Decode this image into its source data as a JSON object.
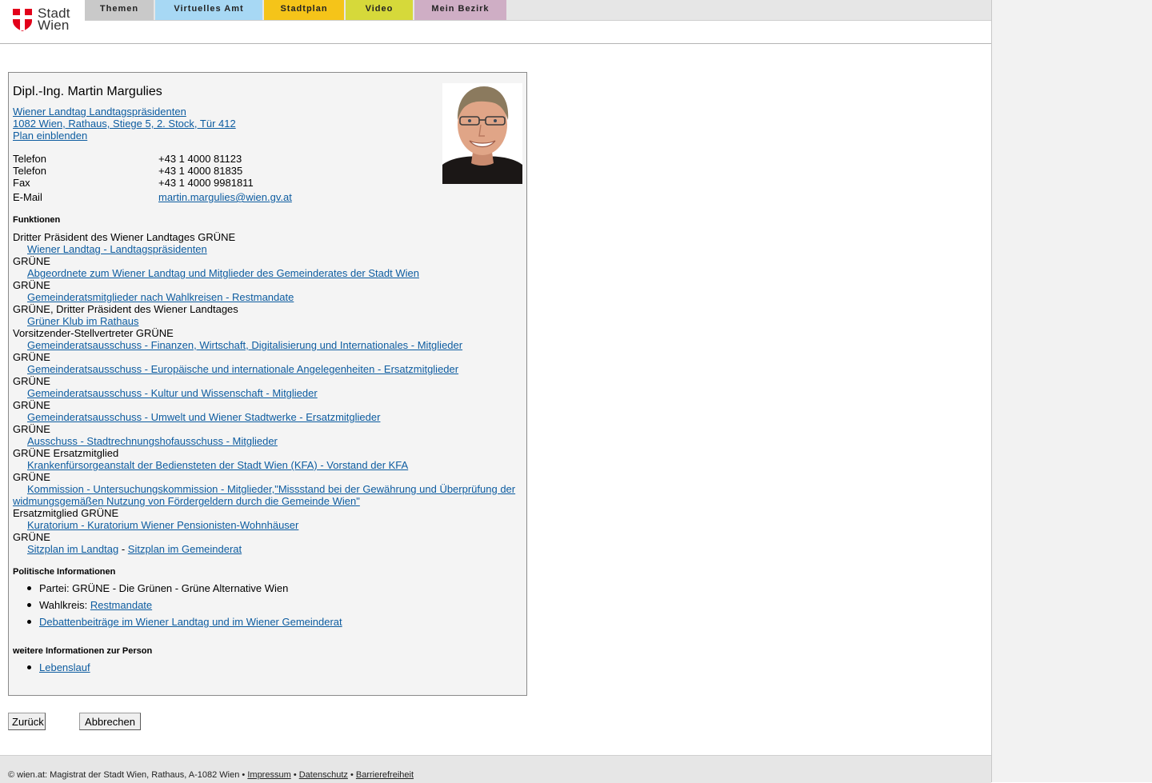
{
  "header": {
    "logo_line1": "Stadt",
    "logo_line2": "Wien",
    "nav": [
      "Themen",
      "Virtuelles Amt",
      "Stadtplan",
      "Video",
      "Mein Bezirk"
    ]
  },
  "person": {
    "name": "Dipl.-Ing. Martin Margulies",
    "org_link": "Wiener Landtag Landtagspräsidenten",
    "address_link": "1082 Wien, Rathaus, Stiege 5, 2. Stock, Tür 412",
    "plan_link": "Plan einblenden",
    "contacts": [
      {
        "label": "Telefon",
        "value": "+43 1 4000 81123"
      },
      {
        "label": "Telefon",
        "value": "+43 1 4000 81835"
      },
      {
        "label": "Fax",
        "value": "+43 1 4000 9981811"
      }
    ],
    "email_label": "E-Mail",
    "email": "martin.margulies@wien.gv.at"
  },
  "funktionen": {
    "heading": "Funktionen",
    "items": [
      {
        "role": "Dritter Präsident des Wiener Landtages GRÜNE",
        "link": "Wiener Landtag - Landtagspräsidenten"
      },
      {
        "role": "GRÜNE",
        "link": "Abgeordnete zum Wiener Landtag und Mitglieder des Gemeinderates der Stadt Wien"
      },
      {
        "role": "GRÜNE",
        "link": "Gemeinderatsmitglieder nach Wahlkreisen - Restmandate"
      },
      {
        "role": "GRÜNE, Dritter Präsident des Wiener Landtages",
        "link": "Grüner Klub im Rathaus"
      },
      {
        "role": "Vorsitzender-Stellvertreter GRÜNE",
        "link": "Gemeinderatsausschuss - Finanzen, Wirtschaft, Digitalisierung und Internationales - Mitglieder"
      },
      {
        "role": "GRÜNE",
        "link": "Gemeinderatsausschuss - Europäische und internationale Angelegenheiten - Ersatzmitglieder"
      },
      {
        "role": "GRÜNE",
        "link": "Gemeinderatsausschuss - Kultur und Wissenschaft - Mitglieder"
      },
      {
        "role": "GRÜNE",
        "link": "Gemeinderatsausschuss - Umwelt und Wiener Stadtwerke - Ersatzmitglieder"
      },
      {
        "role": "GRÜNE",
        "link": "Ausschuss - Stadtrechnungshofausschuss - Mitglieder"
      },
      {
        "role": "GRÜNE Ersatzmitglied",
        "link": "Krankenfürsorgeanstalt der Bediensteten der Stadt Wien (KFA) - Vorstand der KFA"
      },
      {
        "role": "GRÜNE",
        "link": "Kommission - Untersuchungskommission - Mitglieder,\"Missstand bei der Gewährung und Überprüfung der widmungsgemäßen Nutzung von Fördergeldern durch die Gemeinde Wien\"",
        "wrap": true
      },
      {
        "role": "Ersatzmitglied GRÜNE",
        "link": "Kuratorium - Kuratorium Wiener Pensionisten-Wohnhäuser"
      }
    ],
    "last_role": "GRÜNE",
    "seat_link1": "Sitzplan im Landtag",
    "seat_sep": "-",
    "seat_link2": "Sitzplan im Gemeinderat"
  },
  "politik": {
    "heading": "Politische Informationen",
    "partei": "Partei: GRÜNE - Die Grünen - Grüne Alternative Wien",
    "wahlkreis_label": "Wahlkreis:",
    "wahlkreis_link": "Restmandate",
    "debatten_link": "Debattenbeiträge im Wiener Landtag und im Wiener Gemeinderat"
  },
  "weitere": {
    "heading": "weitere Informationen zur Person",
    "lebenslauf_link": "Lebenslauf"
  },
  "buttons": {
    "back": "Zurück",
    "cancel": "Abbrechen"
  },
  "footer": {
    "text": "© wien.at: Magistrat der Stadt Wien, Rathaus, A-1082 Wien",
    "sep": "•",
    "impressum": "Impressum",
    "datenschutz": "Datenschutz",
    "barrierefreiheit": "Barrierefreiheit"
  },
  "colors": {
    "link": "#0d5ca0",
    "nav_themen": "#c9c9c9",
    "nav_virtuelles_amt": "#a7d8f4",
    "nav_stadtplan": "#f5c419",
    "nav_video": "#d6d93a",
    "nav_mein_bezirk": "#cfaec5",
    "logo_red": "#e2001a"
  }
}
